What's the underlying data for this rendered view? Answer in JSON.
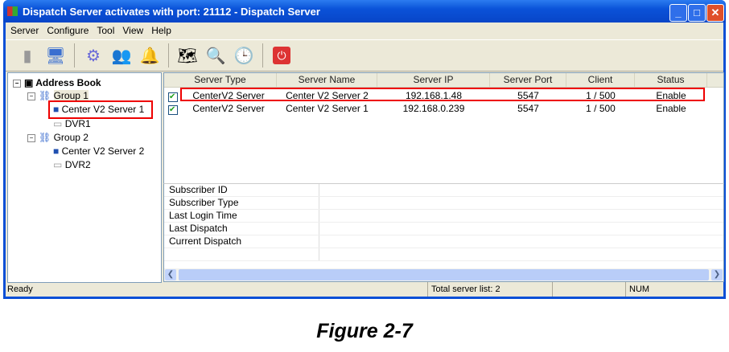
{
  "window": {
    "title": "Dispatch Server activates with port: 21112 - Dispatch Server"
  },
  "menu": [
    "Server",
    "Configure",
    "Tool",
    "View",
    "Help"
  ],
  "toolbar": [
    "server-icon",
    "computer-icon",
    "gear-icon",
    "users-icon",
    "alarm-icon",
    "map-icon",
    "search-icon",
    "clock-icon",
    "power-icon"
  ],
  "tree": {
    "root": "Address Book",
    "groups": [
      {
        "label": "Group 1",
        "children": [
          "Center V2 Server 1",
          "DVR1"
        ]
      },
      {
        "label": "Group 2",
        "children": [
          "Center V2 Server 2",
          "DVR2"
        ]
      }
    ]
  },
  "table": {
    "columns": [
      "Server Type",
      "Server Name",
      "Server IP",
      "Server Port",
      "Client",
      "Status"
    ],
    "rows": [
      [
        "CenterV2 Server",
        "Center V2 Server 2",
        "192.168.1.48",
        "5547",
        "1 / 500",
        "Enable"
      ],
      [
        "CenterV2 Server",
        "Center V2 Server 1",
        "192.168.0.239",
        "5547",
        "1 / 500",
        "Enable"
      ]
    ]
  },
  "properties": [
    "Subscriber ID",
    "Subscriber Type",
    "Last Login Time",
    "Last Dispatch",
    "Current Dispatch"
  ],
  "status": {
    "left": "Ready",
    "total": "Total server list: 2",
    "num": "NUM"
  },
  "caption": "Figure 2-7"
}
